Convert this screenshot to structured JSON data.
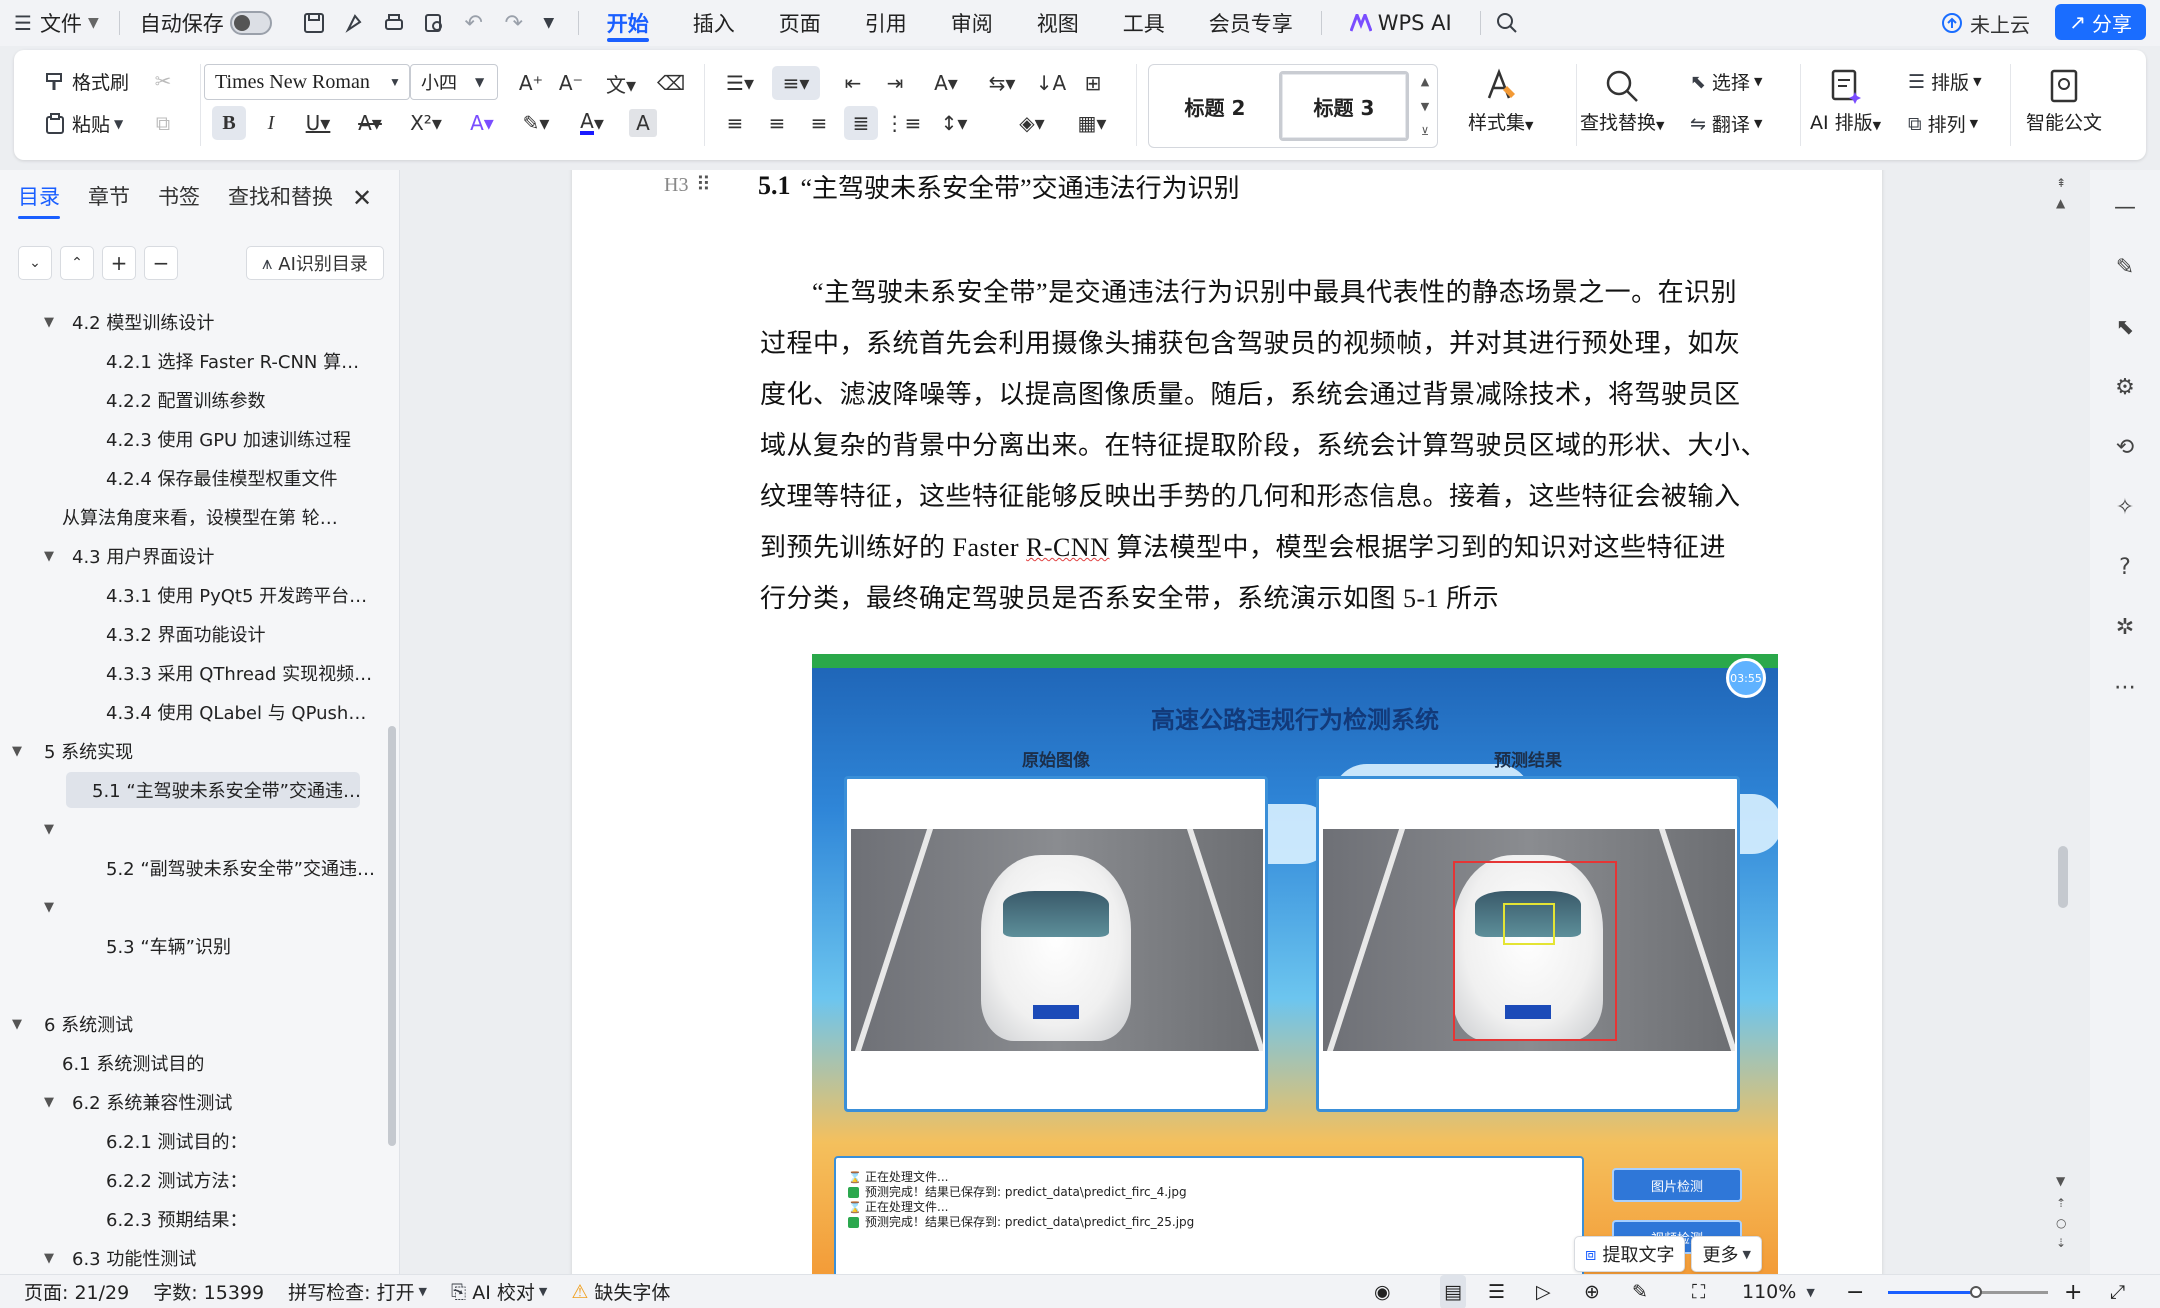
{
  "menubar": {
    "file_label": "文件",
    "autosave_label": "自动保存",
    "tabs": [
      "开始",
      "插入",
      "页面",
      "引用",
      "审阅",
      "视图",
      "工具",
      "会员专享"
    ],
    "active_tab": "开始",
    "wps_ai": "WPS AI",
    "cloud_status": "未上云",
    "share_label": "分享",
    "accent_color": "#1a5fff"
  },
  "ribbon": {
    "format_painter": "格式刷",
    "paste": "粘贴",
    "font_name": "Times New Roman",
    "font_size": "小四",
    "style_h2": "标题 2",
    "style_h3": "标题 3",
    "styles_label": "样式集",
    "find_replace": "查找替换",
    "select": "选择",
    "translate": "翻译",
    "ai_layout": "AI 排版",
    "layout": "排版",
    "arrange": "排列",
    "smart_doc": "智能公文"
  },
  "nav": {
    "tabs": [
      "目录",
      "章节",
      "书签",
      "查找和替换"
    ],
    "active_tab": "目录",
    "ai_toc": "AI识别目录",
    "toc": [
      {
        "text": "4.2 模型训练设计",
        "level": 1,
        "arrow": true
      },
      {
        "text": "4.2.1  选择  Faster R-CNN 算…",
        "level": 2
      },
      {
        "text": "4.2.2  配置训练参数",
        "level": 2
      },
      {
        "text": "4.2.3  使用  GPU  加速训练过程",
        "level": 2
      },
      {
        "text": "4.2.4  保存最佳模型权重文件",
        "level": 2
      },
      {
        "text": "从算法角度来看，设模型在第  轮…",
        "level": 1
      },
      {
        "text": "4.3 用户界面设计",
        "level": 1,
        "arrow": true
      },
      {
        "text": "4.3.1  使用  PyQt5  开发跨平台…",
        "level": 2
      },
      {
        "text": "4.3.2  界面功能设计",
        "level": 2
      },
      {
        "text": "4.3.3  采用  QThread  实现视频…",
        "level": 2
      },
      {
        "text": "4.3.4  使用  QLabel  与  QPush…",
        "level": 2
      },
      {
        "text": "5 系统实现",
        "level": 0,
        "arrow": true
      },
      {
        "text": "5.1 “主驾驶未系安全带”交通违…",
        "level": 2,
        "selected": true
      },
      {
        "text": "",
        "level": 1,
        "arrow": true
      },
      {
        "text": "5.2 “副驾驶未系安全带”交通违…",
        "level": 2
      },
      {
        "text": "",
        "level": 1,
        "arrow": true
      },
      {
        "text": "5.3   “车辆”识别",
        "level": 2
      },
      {
        "text": "",
        "level": 1
      },
      {
        "text": "6 系统测试",
        "level": 0,
        "arrow": true
      },
      {
        "text": "6.1  系统测试目的",
        "level": 1
      },
      {
        "text": "6.2  系统兼容性测试",
        "level": 1,
        "arrow": true
      },
      {
        "text": "6.2.1 测试目的：",
        "level": 2
      },
      {
        "text": "6.2.2 测试方法：",
        "level": 2
      },
      {
        "text": "6.2.3 预期结果：",
        "level": 2
      },
      {
        "text": "6.3  功能性测试",
        "level": 1,
        "arrow": true
      }
    ]
  },
  "doc": {
    "heading_num": "5.1",
    "heading_text": "“主驾驶未系安全带”交通违法行为识别",
    "h3_marker": "H3",
    "lines": [
      "“主驾驶未系安全带”是交通违法行为识别中最具代表性的静态场景之一。在识别",
      "过程中，系统首先会利用摄像头捕获包含驾驶员的视频帧，并对其进行预处理，如灰",
      "度化、滤波降噪等，以提高图像质量。随后，系统会通过背景减除技术，将驾驶员区",
      "域从复杂的背景中分离出来。在特征提取阶段，系统会计算驾驶员区域的形状、大小、",
      "纹理等特征，这些特征能够反映出手势的几何和形态信息。接着，这些特征会被输入",
      "到预先训练好的 Faster R-CNN 算法模型中，模型会根据学习到的知识对这些特征进",
      "行分类，最终确定驾驶员是否系安全带，系统演示如图 5-1 所示"
    ],
    "figure": {
      "title": "高速公路违规行为检测系统",
      "clock": "03:55",
      "panel_left": "原始图像",
      "panel_right": "预测结果",
      "log": [
        {
          "type": "progress",
          "text": "正在处理文件..."
        },
        {
          "type": "done",
          "text": "预测完成！结果已保存到: predict_data\\predict_firc_4.jpg"
        },
        {
          "type": "progress",
          "text": "正在处理文件..."
        },
        {
          "type": "done",
          "text": "预测完成！结果已保存到: predict_data\\predict_firc_25.jpg"
        }
      ],
      "btn_image": "图片检测",
      "btn_video": "视频检测"
    },
    "extract_text": "提取文字",
    "more": "更多"
  },
  "status": {
    "page": "页面: 21/29",
    "words": "字数: 15399",
    "spell": "拼写检查: 打开",
    "ai_proof": "AI 校对",
    "missing_font": "缺失字体",
    "zoom": "110%",
    "zoom_fraction": 0.55
  }
}
